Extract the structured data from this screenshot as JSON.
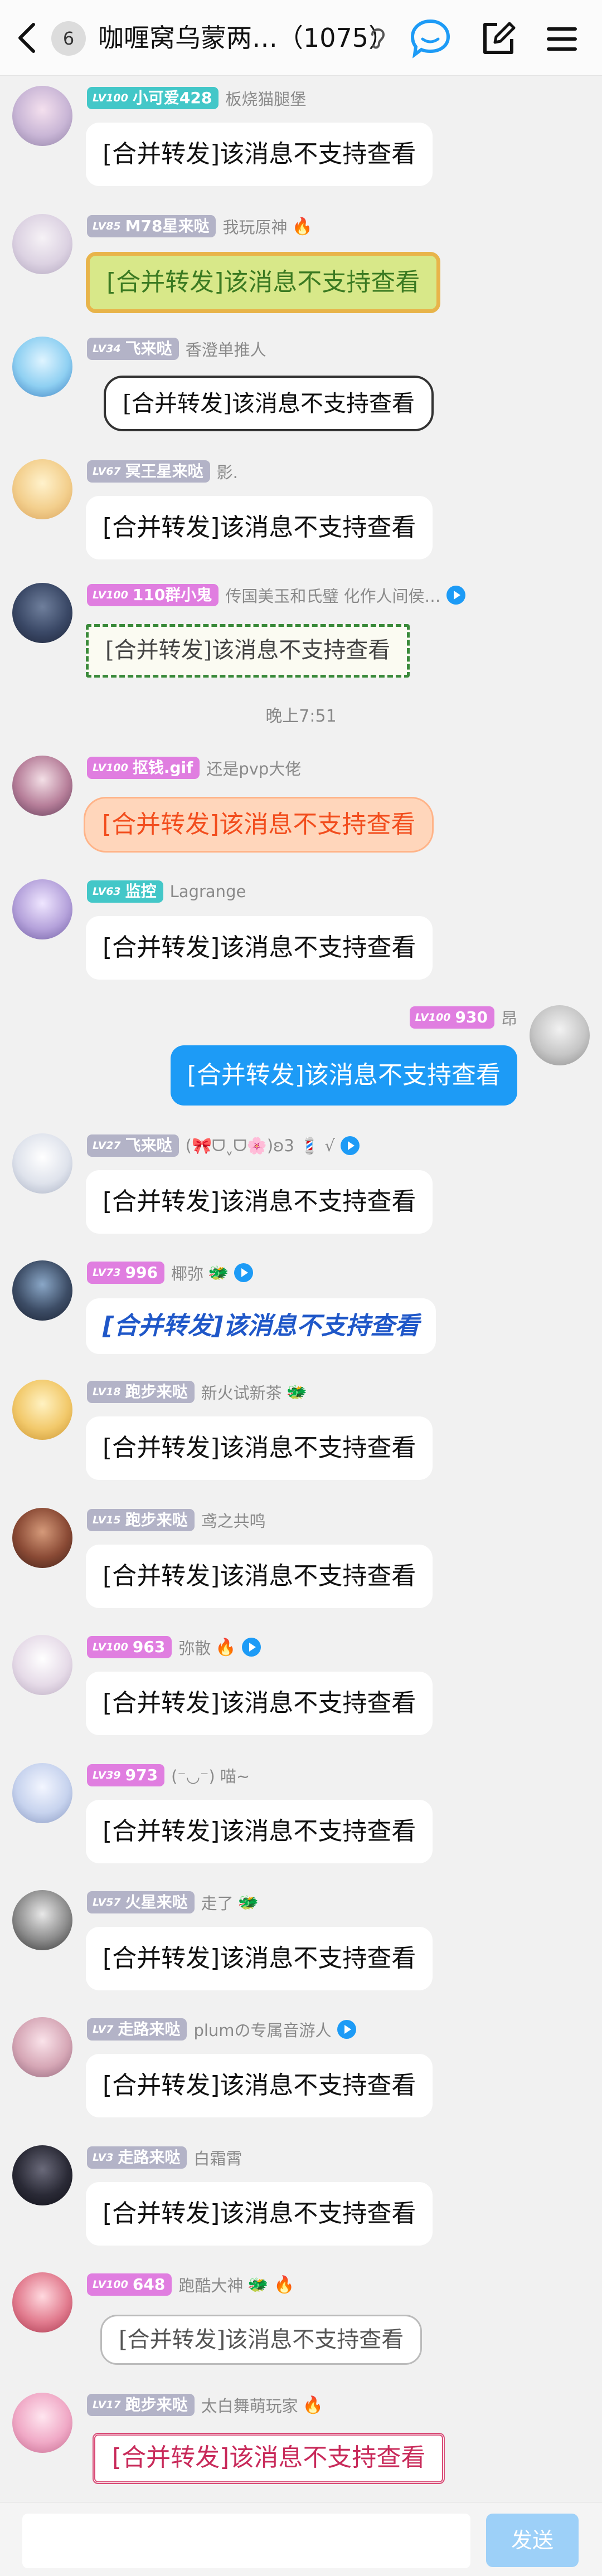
{
  "header": {
    "back_icon": "chevron-left-icon",
    "unread_count": "6",
    "title": "咖喱窝乌蒙两…（1075）",
    "ear_icon": "ear-icon",
    "chat_icon": "chat-bubble-icon",
    "edit_icon": "edit-icon",
    "menu_icon": "menu-icon"
  },
  "colors": {
    "accent": "#1d9bf6",
    "self_bubble": "#1d9bf6",
    "send_disabled": "#9dd0f8"
  },
  "messages": [
    {
      "level": "LV100",
      "title": "小可爱428",
      "tag_color": "#43c7c8",
      "nick": "板烧猫腿堡",
      "extra": "",
      "text": "[合并转发]该消息不支持查看"
    },
    {
      "level": "LV85",
      "title": "M78星来哒",
      "tag_color": "#b3b3c7",
      "nick": "我玩原神",
      "extra": "🔥",
      "text": "[合并转发]该消息不支持查看"
    },
    {
      "level": "LV34",
      "title": "飞来哒",
      "tag_color": "#b3b3c7",
      "nick": "香澄单推人",
      "extra": "",
      "text": "[合并转发]该消息不支持查看"
    },
    {
      "level": "LV67",
      "title": "冥王星来哒",
      "tag_color": "#b3b3c7",
      "nick": "影.",
      "extra": "",
      "text": "[合并转发]该消息不支持查看"
    },
    {
      "level": "LV100",
      "title": "110群小鬼",
      "tag_color": "#e07ee0",
      "nick": "传国美玉和氏璧 化作人间侯…",
      "extra": "",
      "text": "[合并转发]该消息不支持查看"
    },
    {
      "level": "LV100",
      "title": "抠钱.gif",
      "tag_color": "#e07ee0",
      "nick": "还是pvp大佬",
      "extra": "",
      "text": "[合并转发]该消息不支持查看"
    },
    {
      "level": "LV63",
      "title": "监控",
      "tag_color": "#43c7c8",
      "nick": "Lagrange",
      "extra": "",
      "text": "[合并转发]该消息不支持查看"
    },
    {
      "level": "LV100",
      "title": "930",
      "tag_color": "#e07ee0",
      "nick": "昂",
      "extra": "",
      "text": "[合并转发]该消息不支持查看"
    },
    {
      "level": "LV27",
      "title": "飞来哒",
      "tag_color": "#b3b3c7",
      "nick": "(🎀ᗜˬᗜ🌸)ʚ3 💈 √",
      "extra": "",
      "text": "[合并转发]该消息不支持查看"
    },
    {
      "level": "LV73",
      "title": "996",
      "tag_color": "#e07ee0",
      "nick": "椰弥",
      "extra": "🐲",
      "text": "[合并转发]该消息不支持查看"
    },
    {
      "level": "LV18",
      "title": "跑步来哒",
      "tag_color": "#b3b3c7",
      "nick": "新火试新茶",
      "extra": "🐲",
      "text": "[合并转发]该消息不支持查看"
    },
    {
      "level": "LV15",
      "title": "跑步来哒",
      "tag_color": "#b3b3c7",
      "nick": "鸢之共鸣",
      "extra": "",
      "text": "[合并转发]该消息不支持查看"
    },
    {
      "level": "LV100",
      "title": "963",
      "tag_color": "#e07ee0",
      "nick": "弥散",
      "extra": "🔥",
      "text": "[合并转发]该消息不支持查看"
    },
    {
      "level": "LV39",
      "title": "973",
      "tag_color": "#e07ee0",
      "nick": "(⁻◡⁻) 喵~",
      "extra": "",
      "text": "[合并转发]该消息不支持查看"
    },
    {
      "level": "LV57",
      "title": "火星来哒",
      "tag_color": "#b3b3c7",
      "nick": "走了",
      "extra": "🐲",
      "text": "[合并转发]该消息不支持查看"
    },
    {
      "level": "LV7",
      "title": "走路来哒",
      "tag_color": "#b3b3c7",
      "nick": "plumの专属音游人",
      "extra": "",
      "text": "[合并转发]该消息不支持查看"
    },
    {
      "level": "LV3",
      "title": "走路来哒",
      "tag_color": "#b3b3c7",
      "nick": "白霜霄",
      "extra": "",
      "text": "[合并转发]该消息不支持查看"
    },
    {
      "level": "LV100",
      "title": "648",
      "tag_color": "#e07ee0",
      "nick": "跑酷大神",
      "extra": "🐲 🔥",
      "text": "[合并转发]该消息不支持查看"
    },
    {
      "level": "LV17",
      "title": "跑步来哒",
      "tag_color": "#b3b3c7",
      "nick": "太白舞萌玩家",
      "extra": "🔥",
      "text": "[合并转发]该消息不支持查看"
    }
  ],
  "time_divider": "晚上7:51",
  "composer": {
    "send_label": "发送",
    "placeholder": ""
  }
}
